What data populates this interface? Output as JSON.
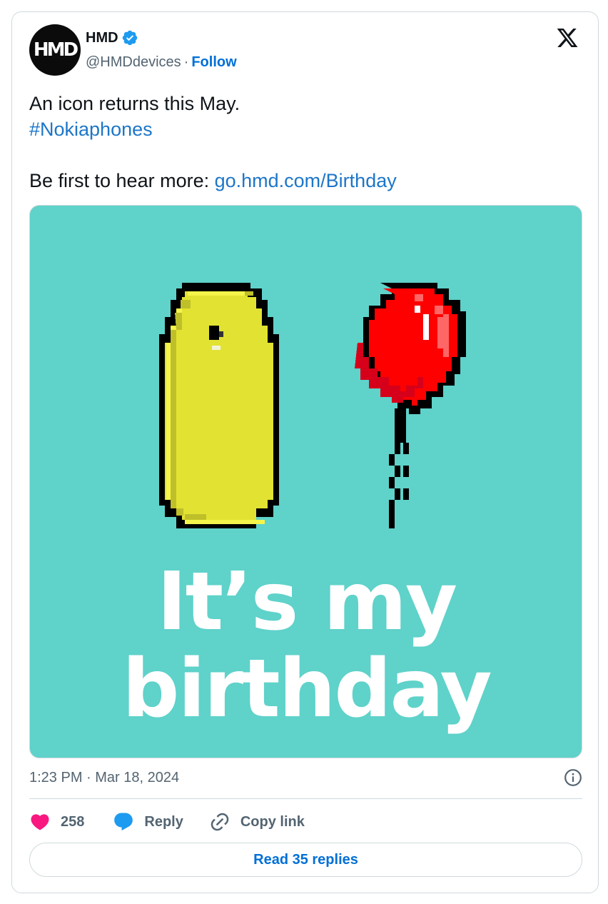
{
  "author": {
    "avatar_text": "HMD",
    "display_name": "HMD",
    "handle": "@HMDdevices",
    "separator": "·",
    "follow_label": "Follow"
  },
  "tweet": {
    "line1": "An icon returns this May.",
    "hashtag": "#Nokiaphones",
    "line3_prefix": "Be first to hear more: ",
    "link": "go.hmd.com/Birthday"
  },
  "media": {
    "headline_line1": "It’s my",
    "headline_line2": "birthday",
    "background_color": "#5fd2ca",
    "phone_color": "#e2e232",
    "balloon_color": "#ff0000"
  },
  "meta": {
    "timestamp": "1:23 PM · Mar 18, 2024"
  },
  "actions": {
    "like_count": "258",
    "reply_label": "Reply",
    "copy_link_label": "Copy link"
  },
  "read_replies_label": "Read 35 replies",
  "colors": {
    "link": "#1d76c8",
    "like": "#f91880",
    "reply": "#1d9bf0",
    "muted": "#536471"
  }
}
